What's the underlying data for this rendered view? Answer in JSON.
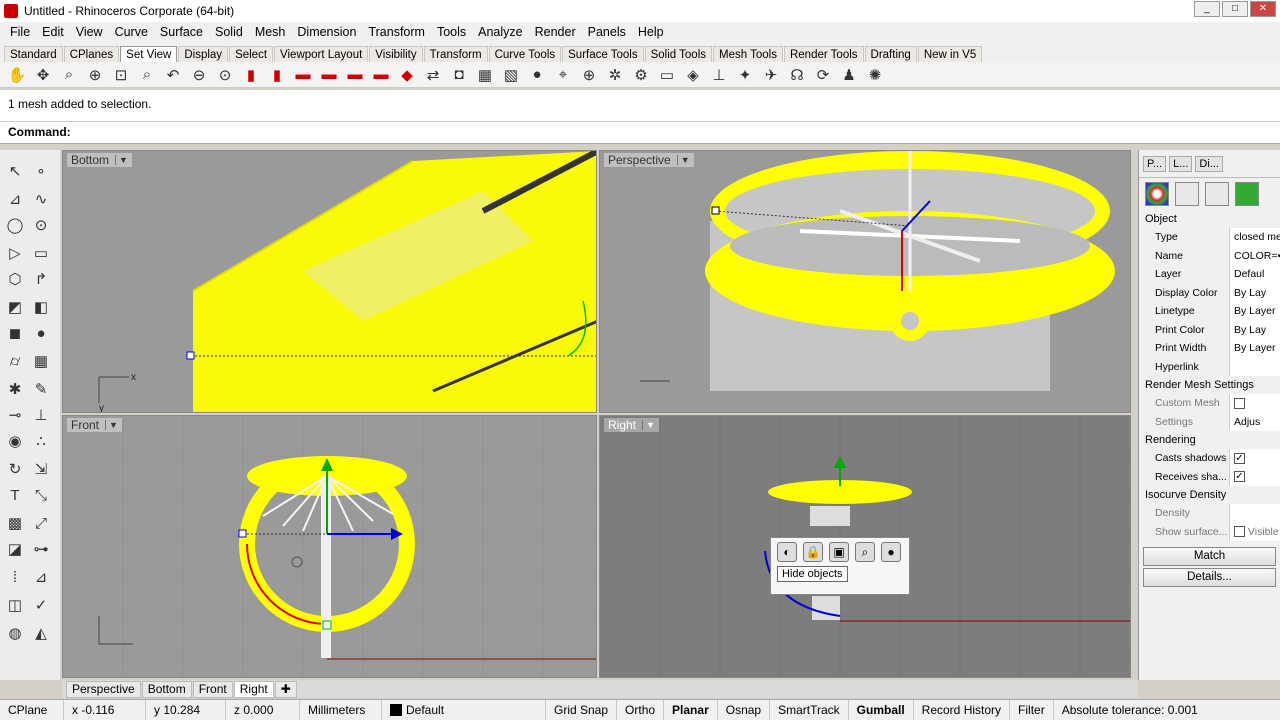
{
  "window": {
    "title": "Untitled - Rhinoceros Corporate (64-bit)"
  },
  "menu": [
    "File",
    "Edit",
    "View",
    "Curve",
    "Surface",
    "Solid",
    "Mesh",
    "Dimension",
    "Transform",
    "Tools",
    "Analyze",
    "Render",
    "Panels",
    "Help"
  ],
  "toolbar_tabs": [
    "Standard",
    "CPlanes",
    "Set View",
    "Display",
    "Select",
    "Viewport Layout",
    "Visibility",
    "Transform",
    "Curve Tools",
    "Surface Tools",
    "Solid Tools",
    "Mesh Tools",
    "Render Tools",
    "Drafting",
    "New in V5"
  ],
  "toolbar_tabs_active": "Set View",
  "command": {
    "history": "1 mesh added to selection.",
    "prompt": "Command:"
  },
  "viewports": {
    "top_left": {
      "label": "Bottom",
      "axis_x": "x",
      "axis_y": "y"
    },
    "top_right": {
      "label": "Perspective"
    },
    "bottom_left": {
      "label": "Front"
    },
    "bottom_right": {
      "label": "Right",
      "active": true
    }
  },
  "popup": {
    "tooltip": "Hide objects"
  },
  "properties": {
    "tabs": [
      "P...",
      "L...",
      "Di..."
    ],
    "section_object": "Object",
    "rows": [
      {
        "key": "Type",
        "value": "closed me"
      },
      {
        "key": "Name",
        "value": "COLOR=•"
      },
      {
        "key": "Layer",
        "value": "Defaul"
      },
      {
        "key": "Display Color",
        "value": "By Lay"
      },
      {
        "key": "Linetype",
        "value": "By Layer"
      },
      {
        "key": "Print Color",
        "value": "By Lay"
      },
      {
        "key": "Print Width",
        "value": "By Layer"
      },
      {
        "key": "Hyperlink",
        "value": ""
      }
    ],
    "section_render_mesh": "Render Mesh Settings",
    "custom_mesh": "Custom Mesh",
    "settings": "Settings",
    "adjust": "Adjus",
    "section_rendering": "Rendering",
    "casts_shadows": "Casts shadows",
    "receives_shadows": "Receives sha...",
    "section_isocurve": "Isocurve Density",
    "density": "Density",
    "show_surface": "Show surface...",
    "visible": "Visible",
    "match_button": "Match",
    "details_button": "Details..."
  },
  "viewport_tabs": [
    "Perspective",
    "Bottom",
    "Front",
    "Right"
  ],
  "viewport_tabs_active": "Right",
  "status": {
    "cplane": "CPlane",
    "x": "x -0.116",
    "y": "y 10.284",
    "z": "z 0.000",
    "units": "Millimeters",
    "layer": "Default",
    "grid_snap": "Grid Snap",
    "ortho": "Ortho",
    "planar": "Planar",
    "osnap": "Osnap",
    "smarttrack": "SmartTrack",
    "gumball": "Gumball",
    "record_history": "Record History",
    "filter": "Filter",
    "tolerance": "Absolute tolerance: 0.001"
  },
  "colors": {
    "mesh_yellow": "#ffff00",
    "viewport_bg": "#9a9a9a",
    "active_vp_bg": "#7d7d7d"
  }
}
